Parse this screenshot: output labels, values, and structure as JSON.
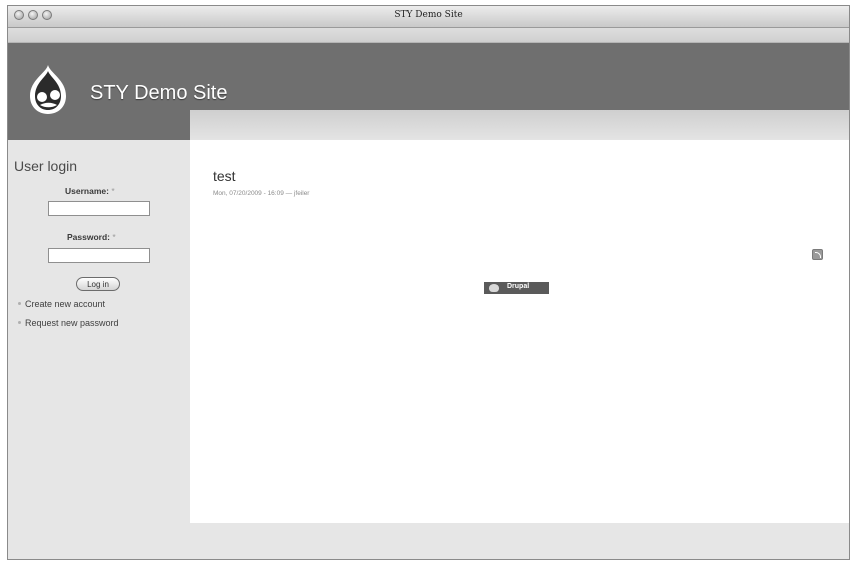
{
  "window": {
    "title": "STY Demo Site"
  },
  "header": {
    "site_name": "STY Demo Site"
  },
  "login_block": {
    "title": "User login",
    "username_label": "Username:",
    "password_label": "Password:",
    "required_marker": "*",
    "username_value": "",
    "password_value": "",
    "submit_label": "Log in",
    "links": [
      "Create new account",
      "Request new password"
    ]
  },
  "node": {
    "title": "test",
    "meta": "Mon, 07/20/2009 - 16:09 — jfeiler"
  },
  "footer": {
    "powered_by": "Drupal"
  },
  "icons": {
    "logo": "drupal-drop-logo",
    "feed": "rss-feed-icon"
  },
  "colors": {
    "header": "#6f6f6f",
    "sidebar": "#e6e6e6",
    "content": "#ffffff"
  }
}
